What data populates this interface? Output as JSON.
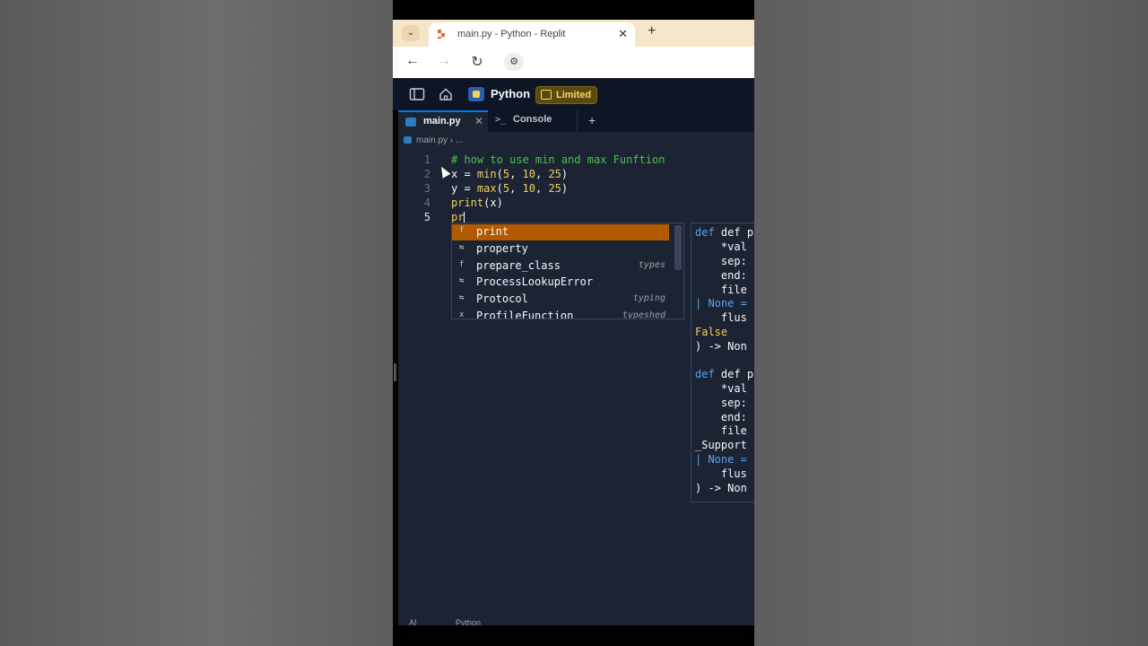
{
  "browser": {
    "tab_title": "main.py - Python - Replit",
    "tab_dropdown_icon": "chevron-down-icon",
    "close_glyph": "✕",
    "new_tab_glyph": "+",
    "back_glyph": "←",
    "forward_glyph": "→",
    "reload_glyph": "↻",
    "site_info_glyph": "⚙"
  },
  "header": {
    "project_name": "Python",
    "plan_badge": "Limited"
  },
  "editor": {
    "tabs": [
      {
        "label": "main.py",
        "close": "✕"
      },
      {
        "label": "Console",
        "prompt": ">_"
      }
    ],
    "add_tab": "+",
    "breadcrumb": {
      "file": "main.py",
      "sep": "›",
      "rest": "..."
    },
    "line_numbers": [
      "1",
      "2",
      "3",
      "4",
      "5"
    ],
    "code": {
      "l1": "# how to use min and max Funftion",
      "l2a": "x",
      "l2b": " = ",
      "l2c": "min",
      "l2d": "(",
      "l2e": "5",
      "l2f": ", ",
      "l2g": "10",
      "l2h": ", ",
      "l2i": "25",
      "l2j": ")",
      "l3a": "y",
      "l3b": " = ",
      "l3c": "max",
      "l3d": "(",
      "l3e": "5",
      "l3f": ", ",
      "l3g": "10",
      "l3h": ", ",
      "l3i": "25",
      "l3j": ")",
      "l4a": "print",
      "l4b": "(x)",
      "l5": "pr"
    }
  },
  "autocomplete": {
    "items": [
      {
        "kind": "f",
        "label": "print",
        "source": ""
      },
      {
        "kind": "⇆",
        "label": "property",
        "source": ""
      },
      {
        "kind": "f",
        "label": "prepare_class",
        "source": "types"
      },
      {
        "kind": "⇆",
        "label": "ProcessLookupError",
        "source": ""
      },
      {
        "kind": "⇆",
        "label": "Protocol",
        "source": "typing"
      },
      {
        "kind": "x",
        "label": "ProfileFunction",
        "source": "typeshed"
      }
    ]
  },
  "hover_doc": {
    "lines": [
      "def prin",
      "    *val",
      "    sep:",
      "    end:",
      "    file",
      "| None =",
      "    flus",
      "False",
      ") -> Non",
      "",
      "def prin",
      "    *val",
      "    sep:",
      "    end:",
      "    file",
      "_Support",
      "| None =",
      "    flus",
      ") -> Non"
    ]
  },
  "status": {
    "ai": "AI",
    "lang": "Python"
  }
}
